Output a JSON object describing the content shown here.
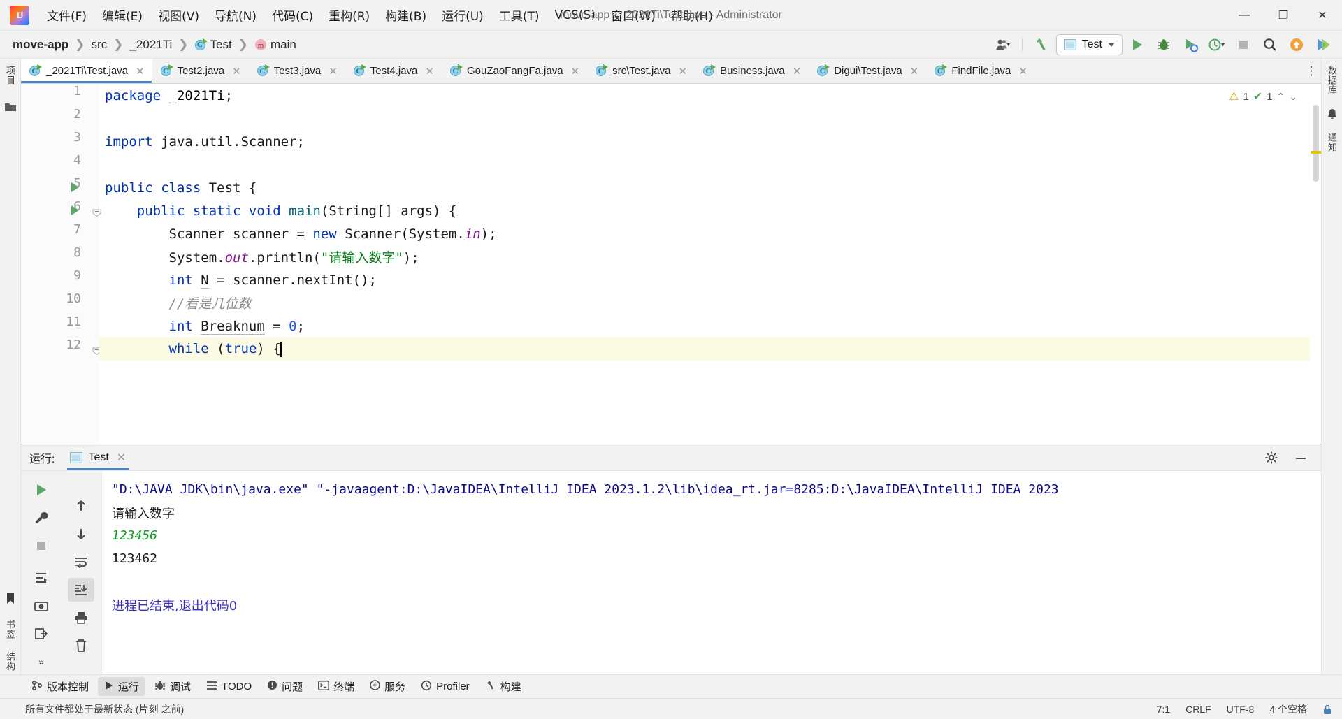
{
  "window": {
    "title": "move-app - _2021Ti\\Test.java - Administrator",
    "minimize": "—",
    "maximize": "❐",
    "close": "✕"
  },
  "menubar": {
    "items": [
      {
        "label": "文件(F)",
        "name": "menu-file"
      },
      {
        "label": "编辑(E)",
        "name": "menu-edit"
      },
      {
        "label": "视图(V)",
        "name": "menu-view"
      },
      {
        "label": "导航(N)",
        "name": "menu-navigate"
      },
      {
        "label": "代码(C)",
        "name": "menu-code"
      },
      {
        "label": "重构(R)",
        "name": "menu-refactor"
      },
      {
        "label": "构建(B)",
        "name": "menu-build"
      },
      {
        "label": "运行(U)",
        "name": "menu-run"
      },
      {
        "label": "工具(T)",
        "name": "menu-tools"
      },
      {
        "label": "VCS(S)",
        "name": "menu-vcs"
      },
      {
        "label": "窗口(W)",
        "name": "menu-window"
      },
      {
        "label": "帮助(H)",
        "name": "menu-help"
      }
    ]
  },
  "breadcrumb": {
    "separator": "❯",
    "items": [
      {
        "label": "move-app",
        "icon": "",
        "bold": true
      },
      {
        "label": "src",
        "icon": "",
        "bold": false
      },
      {
        "label": "_2021Ti",
        "icon": "",
        "bold": false
      },
      {
        "label": "Test",
        "icon": "java-class-icon",
        "bold": false
      },
      {
        "label": "main",
        "icon": "method-icon",
        "bold": false
      }
    ]
  },
  "toolbar": {
    "account_icon": "user-account-icon",
    "hammer_icon": "build-hammer-icon",
    "run_config": "Test",
    "run_icon": "run-icon",
    "debug_icon": "debug-icon",
    "coverage_icon": "run-with-coverage-icon",
    "profiler_icon": "profiler-icon",
    "stop_icon": "stop-icon",
    "search_icon": "search-everywhere-icon",
    "updates_icon": "updates-icon",
    "more_icon": "ide-and-project-settings-icon"
  },
  "editor_tabs": {
    "more": "⋮",
    "items": [
      {
        "label": "_2021Ti\\Test.java",
        "active": true
      },
      {
        "label": "Test2.java",
        "active": false
      },
      {
        "label": "Test3.java",
        "active": false
      },
      {
        "label": "Test4.java",
        "active": false
      },
      {
        "label": "GouZaoFangFa.java",
        "active": false
      },
      {
        "label": "src\\Test.java",
        "active": false
      },
      {
        "label": "Business.java",
        "active": false
      },
      {
        "label": "Digui\\Test.java",
        "active": false
      },
      {
        "label": "FindFile.java",
        "active": false
      }
    ]
  },
  "left_stripe": {
    "project_label": "项目",
    "bookmarks_label": "书签",
    "structure_label": "结构"
  },
  "right_stripe": {
    "database_label": "数据库",
    "notifications_label": "通知"
  },
  "editor": {
    "inspection": {
      "warnings": "1",
      "warning_icon": "warning-triangle-icon",
      "checks": "1",
      "ok_icon": "checkmark-icon",
      "up_icon": "chevron-up-icon",
      "down_icon": "chevron-down-icon"
    },
    "lines": [
      {
        "n": "1",
        "text": "package _2021Ti;"
      },
      {
        "n": "2",
        "text": ""
      },
      {
        "n": "3",
        "text": "import java.util.Scanner;"
      },
      {
        "n": "4",
        "text": ""
      },
      {
        "n": "5",
        "text": "public class Test {"
      },
      {
        "n": "6",
        "text": "    public static void main(String[] args) {"
      },
      {
        "n": "7",
        "text": "        Scanner scanner = new Scanner(System.in);"
      },
      {
        "n": "8",
        "text": "        System.out.println(\"请输入数字\");"
      },
      {
        "n": "9",
        "text": "        int N = scanner.nextInt();"
      },
      {
        "n": "10",
        "text": "        //看是几位数"
      },
      {
        "n": "11",
        "text": "        int Breaknum = 0;"
      },
      {
        "n": "12",
        "text": "        while (true) {"
      }
    ]
  },
  "run_window": {
    "label": "运行:",
    "tab": "Test",
    "tab_close": "✕",
    "settings_icon": "gear-icon",
    "minimize_icon": "minimize-icon",
    "sidebar": [
      {
        "name": "rerun-button",
        "glyph": "▶"
      },
      {
        "name": "wrench-settings-button",
        "glyph": "🔧"
      },
      {
        "name": "stop-button",
        "glyph": "■"
      },
      {
        "name": "thread-dump-button",
        "glyph": "⇱"
      },
      {
        "name": "camera-button",
        "glyph": "📷"
      },
      {
        "name": "export-button",
        "glyph": "⇥"
      },
      {
        "name": "expand-button",
        "glyph": "»"
      }
    ],
    "sidebar2": [
      {
        "name": "up-stack-button",
        "glyph": "↑"
      },
      {
        "name": "down-stack-button",
        "glyph": "↓"
      },
      {
        "name": "soft-wrap-button",
        "glyph": "⇄"
      },
      {
        "name": "scroll-to-end-button",
        "glyph": "⤓"
      },
      {
        "name": "print-button",
        "glyph": "🖶"
      },
      {
        "name": "clear-all-button",
        "glyph": "🗑"
      }
    ],
    "console": [
      {
        "kind": "cmd",
        "text": "\"D:\\JAVA JDK\\bin\\java.exe\" \"-javaagent:D:\\JavaIDEA\\IntelliJ IDEA 2023.1.2\\lib\\idea_rt.jar=8285:D:\\JavaIDEA\\IntelliJ IDEA 2023"
      },
      {
        "kind": "out",
        "text": "请输入数字"
      },
      {
        "kind": "in",
        "text": "123456"
      },
      {
        "kind": "out",
        "text": "123462"
      },
      {
        "kind": "blank",
        "text": ""
      },
      {
        "kind": "end",
        "text": "进程已结束,退出代码0"
      }
    ]
  },
  "bottom_toolwindows": {
    "items": [
      {
        "label": "版本控制",
        "icon": "version-control-icon",
        "active": false
      },
      {
        "label": "运行",
        "icon": "run-icon",
        "active": true
      },
      {
        "label": "调试",
        "icon": "debug-icon",
        "active": false
      },
      {
        "label": "TODO",
        "icon": "todo-icon",
        "active": false
      },
      {
        "label": "问题",
        "icon": "problems-icon",
        "active": false
      },
      {
        "label": "终端",
        "icon": "terminal-icon",
        "active": false
      },
      {
        "label": "服务",
        "icon": "services-icon",
        "active": false
      },
      {
        "label": "Profiler",
        "icon": "profiler-icon",
        "active": false
      },
      {
        "label": "构建",
        "icon": "build-icon",
        "active": false
      }
    ]
  },
  "statusbar": {
    "message": "所有文件都处于最新状态 (片刻 之前)",
    "caret": "7:1",
    "line_separator": "CRLF",
    "encoding": "UTF-8",
    "indent": "4 个空格",
    "lock_icon": "lock-icon"
  },
  "colors": {
    "accent_blue": "#4a86c8",
    "keyword": "#0033b3",
    "string": "#067d17",
    "number": "#1750eb",
    "comment": "#8c8c8c",
    "field": "#871094",
    "console_cmd": "#0a0a8c",
    "console_input": "#0f9d26",
    "console_end": "#3a2fbf",
    "run_green": "#59a869",
    "panel_bg": "#f2f2f2"
  }
}
